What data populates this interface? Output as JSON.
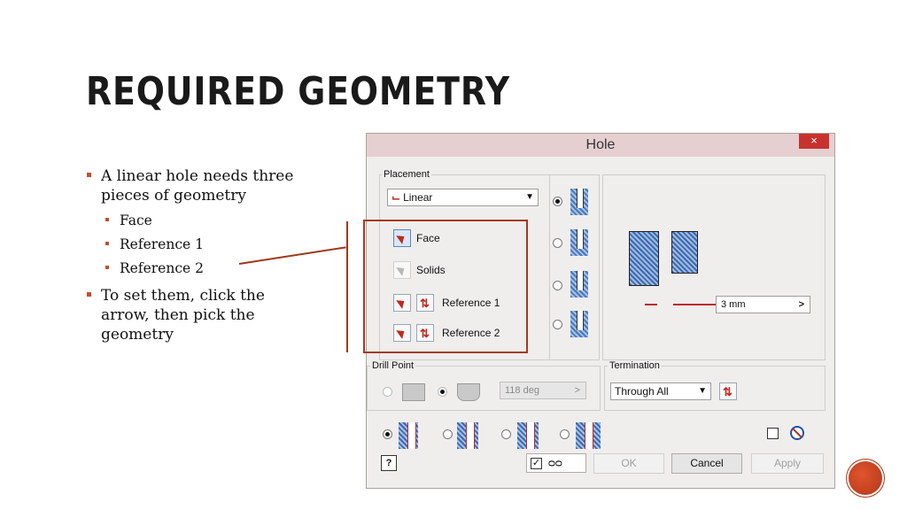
{
  "slide": {
    "title": "REQUIRED GEOMETRY",
    "bullets": {
      "b1": "A linear hole needs three pieces of geometry",
      "s1": "Face",
      "s2": "Reference 1",
      "s3": "Reference 2",
      "b2": "To set them, click the arrow, then pick the geometry"
    }
  },
  "dialog": {
    "title": "Hole",
    "close": "×",
    "placement": {
      "legend": "Placement",
      "type_value": "Linear",
      "items": [
        "Face",
        "Solids",
        "Reference 1",
        "Reference 2"
      ]
    },
    "preview": {
      "distance": "3 mm"
    },
    "drill_point": {
      "legend": "Drill Point",
      "angle": "118 deg"
    },
    "termination": {
      "legend": "Termination",
      "value": "Through All"
    },
    "buttons": {
      "ok": "OK",
      "cancel": "Cancel",
      "apply": "Apply"
    },
    "help_glyph": "?",
    "icons": [
      "dropdown-chevron",
      "select-arrow",
      "flip-arrow",
      "preview-glasses",
      "no-symbol"
    ],
    "colors": {
      "accent": "#a6391a",
      "close": "#c8322e",
      "hatch": "#4b78b9"
    }
  }
}
